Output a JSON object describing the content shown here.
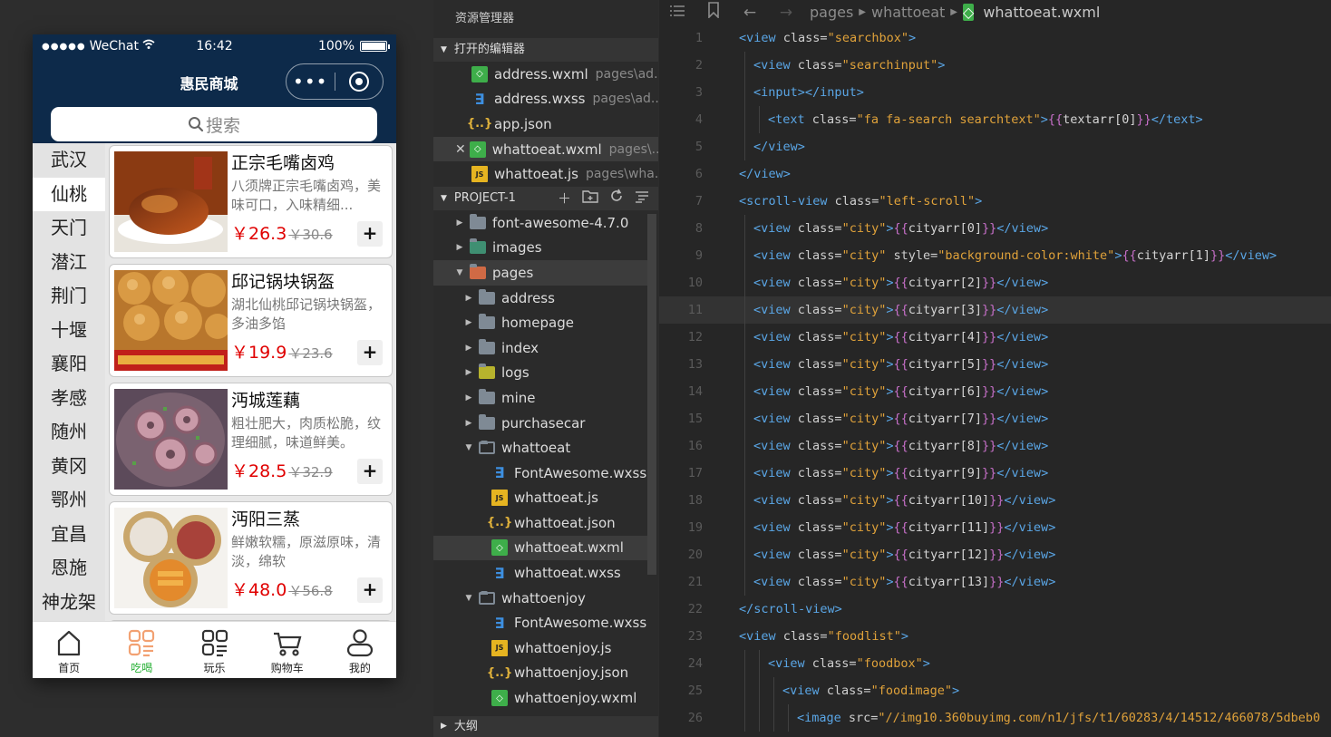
{
  "phone": {
    "status": {
      "carrier": "WeChat",
      "time": "16:42",
      "battery": "100%",
      "battery_level": 1.0
    },
    "nav_title": "惠民商城",
    "search_placeholder": "搜索",
    "cities": [
      "武汉",
      "仙桃",
      "天门",
      "潜江",
      "荆门",
      "十堰",
      "襄阳",
      "孝感",
      "随州",
      "黄冈",
      "鄂州",
      "宜昌",
      "恩施",
      "神龙架"
    ],
    "active_city_index": 1,
    "foods": [
      {
        "name": "正宗毛嘴卤鸡",
        "desc": "八须牌正宗毛嘴卤鸡，美味可口，入味精细...",
        "price": "￥26.3",
        "old_price": "￥30.6"
      },
      {
        "name": "邱记锅块锅盔",
        "desc": "湖北仙桃邱记锅块锅盔，多油多馅",
        "price": "￥19.9",
        "old_price": "￥23.6"
      },
      {
        "name": "沔城莲藕",
        "desc": "粗壮肥大，肉质松脆，纹理细腻，味道鲜美。",
        "price": "￥28.5",
        "old_price": "￥32.9"
      },
      {
        "name": "沔阳三蒸",
        "desc": "鲜嫩软糯，原滋原味，清淡，绵软",
        "price": "￥48.0",
        "old_price": "￥56.8"
      }
    ],
    "add_label": "+",
    "tabs": [
      {
        "label": "首页",
        "icon": "home-icon"
      },
      {
        "label": "吃喝",
        "icon": "food-grid-icon"
      },
      {
        "label": "玩乐",
        "icon": "play-grid-icon"
      },
      {
        "label": "购物车",
        "icon": "cart-icon"
      },
      {
        "label": "我的",
        "icon": "user-icon"
      }
    ],
    "active_tab_index": 1,
    "accent_color": "#27b035",
    "nav_color": "#0d2a4a"
  },
  "explorer": {
    "title": "资源管理器",
    "open_editors_label": "打开的编辑器",
    "open_editors": [
      {
        "name": "address.wxml",
        "path": "pages\\ad...",
        "type": "wxml"
      },
      {
        "name": "address.wxss",
        "path": "pages\\ad...",
        "type": "wxss"
      },
      {
        "name": "app.json",
        "path": "",
        "type": "json"
      },
      {
        "name": "whattoeat.wxml",
        "path": "pages\\...",
        "type": "wxml",
        "active": true
      },
      {
        "name": "whattoeat.js",
        "path": "pages\\wha...",
        "type": "js"
      }
    ],
    "project_label": "PROJECT-1",
    "tree": [
      {
        "name": "font-awesome-4.7.0",
        "kind": "folder",
        "depth": 0
      },
      {
        "name": "images",
        "kind": "folder-img",
        "depth": 0
      },
      {
        "name": "pages",
        "kind": "folder-pages",
        "depth": 0,
        "open": true
      },
      {
        "name": "address",
        "kind": "folder",
        "depth": 1
      },
      {
        "name": "homepage",
        "kind": "folder",
        "depth": 1
      },
      {
        "name": "index",
        "kind": "folder",
        "depth": 1
      },
      {
        "name": "logs",
        "kind": "folder-logs",
        "depth": 1
      },
      {
        "name": "mine",
        "kind": "folder",
        "depth": 1
      },
      {
        "name": "purchasecar",
        "kind": "folder",
        "depth": 1
      },
      {
        "name": "whattoeat",
        "kind": "folder-open",
        "depth": 1,
        "open": true
      },
      {
        "name": "FontAwesome.wxss",
        "kind": "wxss",
        "depth": 2
      },
      {
        "name": "whattoeat.js",
        "kind": "js",
        "depth": 2
      },
      {
        "name": "whattoeat.json",
        "kind": "json",
        "depth": 2
      },
      {
        "name": "whattoeat.wxml",
        "kind": "wxml",
        "depth": 2,
        "active": true
      },
      {
        "name": "whattoeat.wxss",
        "kind": "wxss",
        "depth": 2
      },
      {
        "name": "whattoenjoy",
        "kind": "folder-open",
        "depth": 1,
        "open": true
      },
      {
        "name": "FontAwesome.wxss",
        "kind": "wxss",
        "depth": 2
      },
      {
        "name": "whattoenjoy.js",
        "kind": "js",
        "depth": 2
      },
      {
        "name": "whattoenjoy.json",
        "kind": "json",
        "depth": 2
      },
      {
        "name": "whattoenjoy.wxml",
        "kind": "wxml",
        "depth": 2
      }
    ],
    "outline_label": "大纲"
  },
  "editor": {
    "breadcrumb": [
      "pages",
      "whattoeat",
      "whattoeat.wxml"
    ],
    "current_line": 11,
    "lines": [
      {
        "n": "1",
        "indent": 0,
        "tokens": [
          [
            "tag",
            "<view "
          ],
          [
            "attr",
            "class="
          ],
          [
            "str",
            "\"searchbox\""
          ],
          [
            "tag",
            ">"
          ]
        ]
      },
      {
        "n": "2",
        "indent": 1,
        "tokens": [
          [
            "tag",
            "<view "
          ],
          [
            "attr",
            "class="
          ],
          [
            "str",
            "\"searchinput\""
          ],
          [
            "tag",
            ">"
          ]
        ]
      },
      {
        "n": "3",
        "indent": 1,
        "tokens": [
          [
            "tag",
            "<input></input>"
          ]
        ]
      },
      {
        "n": "4",
        "indent": 2,
        "tokens": [
          [
            "tag",
            "<text "
          ],
          [
            "attr",
            "class="
          ],
          [
            "str",
            "\"fa fa-search searchtext\""
          ],
          [
            "tag",
            ">"
          ],
          [
            "brace",
            "{{"
          ],
          [
            "var",
            "textarr[0]"
          ],
          [
            "brace",
            "}}"
          ],
          [
            "tag",
            "</text>"
          ]
        ]
      },
      {
        "n": "5",
        "indent": 1,
        "tokens": [
          [
            "tag",
            "</view>"
          ]
        ]
      },
      {
        "n": "6",
        "indent": 0,
        "tokens": [
          [
            "tag",
            "</view>"
          ]
        ]
      },
      {
        "n": "7",
        "indent": 0,
        "tokens": [
          [
            "tag",
            "<scroll-view "
          ],
          [
            "attr",
            "class="
          ],
          [
            "str",
            "\"left-scroll\""
          ],
          [
            "tag",
            ">"
          ]
        ]
      },
      {
        "n": "8",
        "indent": 1,
        "tokens": [
          [
            "tag",
            "<view "
          ],
          [
            "attr",
            "class="
          ],
          [
            "str",
            "\"city\""
          ],
          [
            "tag",
            ">"
          ],
          [
            "brace",
            "{{"
          ],
          [
            "var",
            "cityarr[0]"
          ],
          [
            "brace",
            "}}"
          ],
          [
            "tag",
            "</view>"
          ]
        ]
      },
      {
        "n": "9",
        "indent": 1,
        "tokens": [
          [
            "tag",
            "<view "
          ],
          [
            "attr",
            "class="
          ],
          [
            "str",
            "\"city\""
          ],
          [
            "attr",
            " style="
          ],
          [
            "str",
            "\"background-color:white\""
          ],
          [
            "tag",
            ">"
          ],
          [
            "brace",
            "{{"
          ],
          [
            "var",
            "cityarr[1]"
          ],
          [
            "brace",
            "}}"
          ],
          [
            "tag",
            "</view>"
          ]
        ]
      },
      {
        "n": "10",
        "indent": 1,
        "tokens": [
          [
            "tag",
            "<view "
          ],
          [
            "attr",
            "class="
          ],
          [
            "str",
            "\"city\""
          ],
          [
            "tag",
            ">"
          ],
          [
            "brace",
            "{{"
          ],
          [
            "var",
            "cityarr[2]"
          ],
          [
            "brace",
            "}}"
          ],
          [
            "tag",
            "</view>"
          ]
        ]
      },
      {
        "n": "11",
        "indent": 1,
        "tokens": [
          [
            "tag",
            "<view "
          ],
          [
            "attr",
            "class="
          ],
          [
            "str",
            "\"city\""
          ],
          [
            "tag",
            ">"
          ],
          [
            "brace",
            "{{"
          ],
          [
            "var",
            "cityarr[3]"
          ],
          [
            "brace",
            "}}"
          ],
          [
            "tag",
            "</view>"
          ]
        ]
      },
      {
        "n": "12",
        "indent": 1,
        "tokens": [
          [
            "tag",
            "<view "
          ],
          [
            "attr",
            "class="
          ],
          [
            "str",
            "\"city\""
          ],
          [
            "tag",
            ">"
          ],
          [
            "brace",
            "{{"
          ],
          [
            "var",
            "cityarr[4]"
          ],
          [
            "brace",
            "}}"
          ],
          [
            "tag",
            "</view>"
          ]
        ]
      },
      {
        "n": "13",
        "indent": 1,
        "tokens": [
          [
            "tag",
            "<view "
          ],
          [
            "attr",
            "class="
          ],
          [
            "str",
            "\"city\""
          ],
          [
            "tag",
            ">"
          ],
          [
            "brace",
            "{{"
          ],
          [
            "var",
            "cityarr[5]"
          ],
          [
            "brace",
            "}}"
          ],
          [
            "tag",
            "</view>"
          ]
        ]
      },
      {
        "n": "14",
        "indent": 1,
        "tokens": [
          [
            "tag",
            "<view "
          ],
          [
            "attr",
            "class="
          ],
          [
            "str",
            "\"city\""
          ],
          [
            "tag",
            ">"
          ],
          [
            "brace",
            "{{"
          ],
          [
            "var",
            "cityarr[6]"
          ],
          [
            "brace",
            "}}"
          ],
          [
            "tag",
            "</view>"
          ]
        ]
      },
      {
        "n": "15",
        "indent": 1,
        "tokens": [
          [
            "tag",
            "<view "
          ],
          [
            "attr",
            "class="
          ],
          [
            "str",
            "\"city\""
          ],
          [
            "tag",
            ">"
          ],
          [
            "brace",
            "{{"
          ],
          [
            "var",
            "cityarr[7]"
          ],
          [
            "brace",
            "}}"
          ],
          [
            "tag",
            "</view>"
          ]
        ]
      },
      {
        "n": "16",
        "indent": 1,
        "tokens": [
          [
            "tag",
            "<view "
          ],
          [
            "attr",
            "class="
          ],
          [
            "str",
            "\"city\""
          ],
          [
            "tag",
            ">"
          ],
          [
            "brace",
            "{{"
          ],
          [
            "var",
            "cityarr[8]"
          ],
          [
            "brace",
            "}}"
          ],
          [
            "tag",
            "</view>"
          ]
        ]
      },
      {
        "n": "17",
        "indent": 1,
        "tokens": [
          [
            "tag",
            "<view "
          ],
          [
            "attr",
            "class="
          ],
          [
            "str",
            "\"city\""
          ],
          [
            "tag",
            ">"
          ],
          [
            "brace",
            "{{"
          ],
          [
            "var",
            "cityarr[9]"
          ],
          [
            "brace",
            "}}"
          ],
          [
            "tag",
            "</view>"
          ]
        ]
      },
      {
        "n": "18",
        "indent": 1,
        "tokens": [
          [
            "tag",
            "<view "
          ],
          [
            "attr",
            "class="
          ],
          [
            "str",
            "\"city\""
          ],
          [
            "tag",
            ">"
          ],
          [
            "brace",
            "{{"
          ],
          [
            "var",
            "cityarr[10]"
          ],
          [
            "brace",
            "}}"
          ],
          [
            "tag",
            "</view>"
          ]
        ]
      },
      {
        "n": "19",
        "indent": 1,
        "tokens": [
          [
            "tag",
            "<view "
          ],
          [
            "attr",
            "class="
          ],
          [
            "str",
            "\"city\""
          ],
          [
            "tag",
            ">"
          ],
          [
            "brace",
            "{{"
          ],
          [
            "var",
            "cityarr[11]"
          ],
          [
            "brace",
            "}}"
          ],
          [
            "tag",
            "</view>"
          ]
        ]
      },
      {
        "n": "20",
        "indent": 1,
        "tokens": [
          [
            "tag",
            "<view "
          ],
          [
            "attr",
            "class="
          ],
          [
            "str",
            "\"city\""
          ],
          [
            "tag",
            ">"
          ],
          [
            "brace",
            "{{"
          ],
          [
            "var",
            "cityarr[12]"
          ],
          [
            "brace",
            "}}"
          ],
          [
            "tag",
            "</view>"
          ]
        ]
      },
      {
        "n": "21",
        "indent": 1,
        "tokens": [
          [
            "tag",
            "<view "
          ],
          [
            "attr",
            "class="
          ],
          [
            "str",
            "\"city\""
          ],
          [
            "tag",
            ">"
          ],
          [
            "brace",
            "{{"
          ],
          [
            "var",
            "cityarr[13]"
          ],
          [
            "brace",
            "}}"
          ],
          [
            "tag",
            "</view>"
          ]
        ]
      },
      {
        "n": "22",
        "indent": 0,
        "tokens": [
          [
            "tag",
            "</scroll-view>"
          ]
        ]
      },
      {
        "n": "23",
        "indent": 0,
        "tokens": [
          [
            "tag",
            "<view "
          ],
          [
            "attr",
            "class="
          ],
          [
            "str",
            "\"foodlist\""
          ],
          [
            "tag",
            ">"
          ]
        ]
      },
      {
        "n": "24",
        "indent": 2,
        "tokens": [
          [
            "tag",
            "<view "
          ],
          [
            "attr",
            "class="
          ],
          [
            "str",
            "\"foodbox\""
          ],
          [
            "tag",
            ">"
          ]
        ]
      },
      {
        "n": "25",
        "indent": 3,
        "tokens": [
          [
            "tag",
            "<view "
          ],
          [
            "attr",
            "class="
          ],
          [
            "str",
            "\"foodimage\""
          ],
          [
            "tag",
            ">"
          ]
        ]
      },
      {
        "n": "26",
        "indent": 4,
        "tokens": [
          [
            "tag",
            "<image "
          ],
          [
            "attr",
            "src="
          ],
          [
            "url",
            "\"//img10.360buyimg.com/n1/jfs/t1/60283/4/14512/466078/5dbeb0"
          ]
        ]
      }
    ]
  }
}
